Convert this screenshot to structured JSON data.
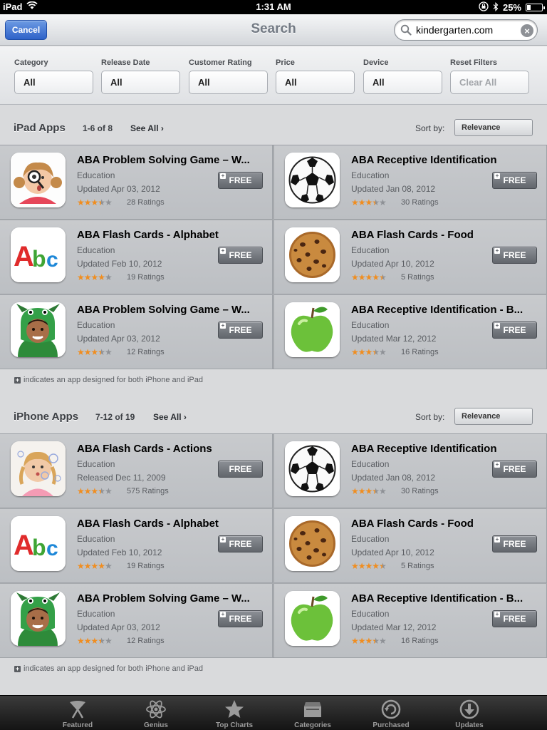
{
  "status_bar": {
    "carrier": "iPad",
    "time": "1:31 AM",
    "battery": "25%",
    "battery_level": 0.25
  },
  "navbar": {
    "cancel_label": "Cancel",
    "title": "Search",
    "search_value": "kindergarten.com"
  },
  "filters": [
    {
      "label": "Category",
      "value": "All"
    },
    {
      "label": "Release Date",
      "value": "All"
    },
    {
      "label": "Customer Rating",
      "value": "All"
    },
    {
      "label": "Price",
      "value": "All"
    },
    {
      "label": "Device",
      "value": "All"
    },
    {
      "label": "Reset Filters",
      "value": "Clear All"
    }
  ],
  "sections": [
    {
      "title": "iPad Apps",
      "count": "1-6 of 8",
      "see_all": "See All",
      "sort_label": "Sort by:",
      "sort_value": "Relevance",
      "apps": [
        {
          "name": "ABA Problem Solving Game – W...",
          "category": "Education",
          "date": "Updated Apr 03, 2012",
          "rating": 3.5,
          "ratings": "28 Ratings",
          "button": "FREE",
          "universal": true,
          "icon": "girl-magnifier-icon"
        },
        {
          "name": "ABA Receptive Identification",
          "category": "Education",
          "date": "Updated Jan 08, 2012",
          "rating": 3.5,
          "ratings": "30 Ratings",
          "button": "FREE",
          "universal": true,
          "icon": "soccer-ball-icon"
        },
        {
          "name": "ABA Flash Cards - Alphabet",
          "category": "Education",
          "date": "Updated Feb 10, 2012",
          "rating": 4,
          "ratings": "19 Ratings",
          "button": "FREE",
          "universal": true,
          "icon": "abc-letters-icon"
        },
        {
          "name": "ABA Flash Cards - Food",
          "category": "Education",
          "date": "Updated Apr 10, 2012",
          "rating": 4.5,
          "ratings": "5 Ratings",
          "button": "FREE",
          "universal": true,
          "icon": "cookie-icon"
        },
        {
          "name": "ABA Problem Solving Game – W...",
          "category": "Education",
          "date": "Updated Apr 03, 2012",
          "rating": 3.5,
          "ratings": "12 Ratings",
          "button": "FREE",
          "universal": true,
          "icon": "kid-dragon-costume-icon"
        },
        {
          "name": "ABA Receptive Identification - B...",
          "category": "Education",
          "date": "Updated Mar 12, 2012",
          "rating": 3.5,
          "ratings": "16 Ratings",
          "button": "FREE",
          "universal": true,
          "icon": "green-apple-icon"
        }
      ],
      "note": "indicates an app designed for both iPhone and iPad"
    },
    {
      "title": "iPhone Apps",
      "count": "7-12 of 19",
      "see_all": "See All",
      "sort_label": "Sort by:",
      "sort_value": "Relevance",
      "apps": [
        {
          "name": "ABA Flash Cards - Actions",
          "category": "Education",
          "date": "Released Dec 11, 2009",
          "rating": 3.5,
          "ratings": "575 Ratings",
          "button": "FREE",
          "universal": false,
          "icon": "girl-bubbles-icon"
        },
        {
          "name": "ABA Receptive Identification",
          "category": "Education",
          "date": "Updated Jan 08, 2012",
          "rating": 3.5,
          "ratings": "30 Ratings",
          "button": "FREE",
          "universal": true,
          "icon": "soccer-ball-icon"
        },
        {
          "name": "ABA Flash Cards - Alphabet",
          "category": "Education",
          "date": "Updated Feb 10, 2012",
          "rating": 4,
          "ratings": "19 Ratings",
          "button": "FREE",
          "universal": true,
          "icon": "abc-letters-icon"
        },
        {
          "name": "ABA Flash Cards - Food",
          "category": "Education",
          "date": "Updated Apr 10, 2012",
          "rating": 4.5,
          "ratings": "5 Ratings",
          "button": "FREE",
          "universal": true,
          "icon": "cookie-icon"
        },
        {
          "name": "ABA Problem Solving Game – W...",
          "category": "Education",
          "date": "Updated Apr 03, 2012",
          "rating": 3.5,
          "ratings": "12 Ratings",
          "button": "FREE",
          "universal": true,
          "icon": "kid-dragon-costume-icon"
        },
        {
          "name": "ABA Receptive Identification - B...",
          "category": "Education",
          "date": "Updated Mar 12, 2012",
          "rating": 3.5,
          "ratings": "16 Ratings",
          "button": "FREE",
          "universal": true,
          "icon": "green-apple-icon"
        }
      ],
      "note": "indicates an app designed for both iPhone and iPad"
    }
  ],
  "tabbar": [
    {
      "label": "Featured",
      "icon": "featured-icon"
    },
    {
      "label": "Genius",
      "icon": "genius-atom-icon"
    },
    {
      "label": "Top Charts",
      "icon": "star-icon"
    },
    {
      "label": "Categories",
      "icon": "categories-box-icon"
    },
    {
      "label": "Purchased",
      "icon": "purchased-icon"
    },
    {
      "label": "Updates",
      "icon": "updates-icon"
    }
  ],
  "colors": {
    "accent": "#2e62c9",
    "star": "#f08d1f",
    "free_button": "#62666c"
  }
}
